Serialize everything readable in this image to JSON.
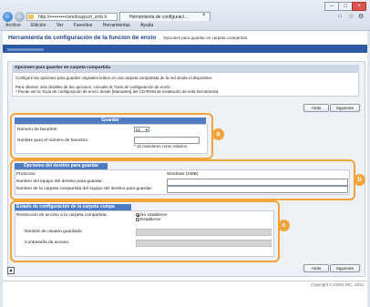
{
  "browser": {
    "url": "http://••••••••••/sendsupport_smb.h",
    "tab_title": "Herramienta de configuraci...",
    "menu": [
      "Archivo",
      "Edición",
      "Ver",
      "Favoritos",
      "Herramientas",
      "Ayuda"
    ]
  },
  "header": {
    "title": "Herramienta de configuración de la función de envío",
    "subtitle": "Opciones para guardar en carpeta compartida"
  },
  "options": {
    "heading": "Opciones para guardar en carpeta compartida",
    "line1": "Configure las opciones para guardar originales leídos en una carpeta compartida de la red desde el dispositivo.",
    "line2": "Para obtener más detalles de las opciones, consulte la 'Guía de configuración de envío'.",
    "line3": "* Puede ver la 'Guía de configuración de envío' desde [Manuales] del CD-ROM de instalación de esta herramienta."
  },
  "buttons": {
    "back": "Atrás",
    "next": "Siguiente"
  },
  "guardar": {
    "heading": "Guardar",
    "fav_label": "Número de favoritos:",
    "fav_value": "01",
    "name_label": "Nombre para el número de favoritos:",
    "name_hint": "* 16 caracteres como máximo"
  },
  "destino": {
    "heading": "Opciones del destino para guardar",
    "protocol_label": "Protocolo:",
    "protocol_value": "Windows (SMB)",
    "pc_label": "Nombre del equipo del destino para guardar:",
    "folder_label": "Nombre de la carpeta compartida del equipo del destino para guardar:"
  },
  "estado": {
    "heading": "Estado de configuración de la carpeta compa",
    "restrict_label": "Restricción de acceso a la carpeta compartida:",
    "opt_no": "No establecer",
    "opt_yes": "Establecer",
    "user_label": "Nombre de usuario guardado:",
    "pass_label": "Contraseña de acceso:"
  },
  "badges": {
    "a": "a",
    "b": "b",
    "c": "c"
  },
  "footer": {
    "copyright": "Copyright CANON INC. 2014"
  },
  "colors": {
    "accent": "#2d5aa6",
    "callout": "#f0a43a",
    "section_head": "#4d7cc4"
  }
}
